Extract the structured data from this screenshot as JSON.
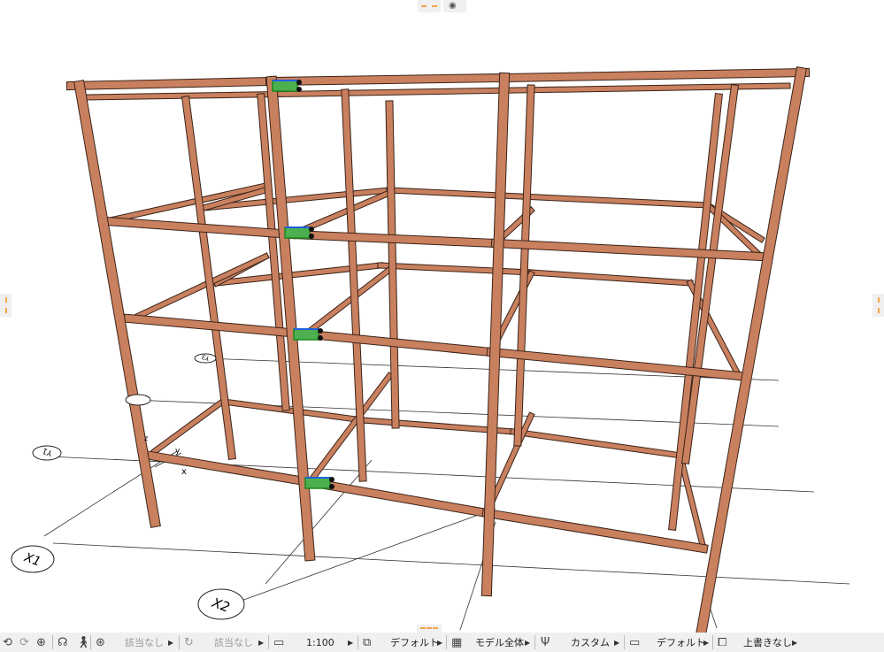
{
  "view": {
    "grid_labels": [
      "X1",
      "X2",
      "Y1",
      "Y3"
    ],
    "axis_labels": [
      "x",
      "y",
      "z"
    ],
    "member_color": "#c9805f",
    "member_edge": "#3a2318"
  },
  "toolbar": {
    "undo_icon": "undo-view-icon",
    "redo_icon": "redo-view-icon",
    "zoom_icon": "zoom-in-icon",
    "orbit_icon": "orbit-icon",
    "walk_icon": "walk-icon",
    "filter_label": "該当なし",
    "filter2_label": "該当なし",
    "scale_label": "1:100",
    "layer_label": "デフォルト",
    "model_view_label": "モデル全体",
    "pen_set_label": "カスタム",
    "dimension_label": "デフォルト",
    "override_label": "上書きなし"
  }
}
